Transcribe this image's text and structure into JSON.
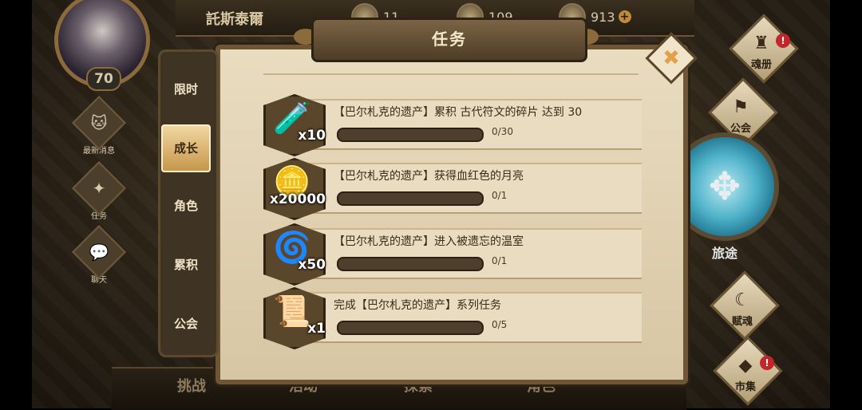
{
  "player": {
    "name": "託斯泰爾",
    "level": "70"
  },
  "resources": [
    {
      "icon": "coin-icon",
      "value": "11"
    },
    {
      "icon": "gem-icon",
      "value": "109"
    },
    {
      "icon": "soul-stone-icon",
      "value": "913"
    }
  ],
  "left_sidebar": [
    {
      "label": "最新消息",
      "icon": "cat-icon"
    },
    {
      "label": "任务",
      "icon": "crest-icon"
    },
    {
      "label": "聊天",
      "icon": "chat-icon"
    }
  ],
  "panel": {
    "title": "任务",
    "close_label": "✖"
  },
  "tabs": [
    {
      "label": "限时",
      "active": false
    },
    {
      "label": "成长",
      "active": true
    },
    {
      "label": "角色",
      "active": false
    },
    {
      "label": "累积",
      "active": false
    },
    {
      "label": "公会",
      "active": false
    }
  ],
  "tasks": [
    {
      "desc": "【巴尔札克的遗产】累积 古代符文的碎片 达到 30",
      "reward_qty": "x10",
      "progress": "0/30",
      "progress_fraction": 0,
      "reward_icon": "potion-icon"
    },
    {
      "desc": "【巴尔札克的遗产】获得血红色的月亮",
      "reward_qty": "x20000",
      "progress": "0/1",
      "progress_fraction": 0,
      "reward_icon": "gold-coin-icon"
    },
    {
      "desc": "【巴尔札克的遗产】进入被遗忘的温室",
      "reward_qty": "x50",
      "progress": "0/1",
      "progress_fraction": 0,
      "reward_icon": "spirit-swirl-icon"
    },
    {
      "desc": "完成【巴尔札克的遗产】系列任务",
      "reward_qty": "x1",
      "progress": "0/5",
      "progress_fraction": 0,
      "reward_icon": "relic-icon"
    }
  ],
  "right_sidebar": [
    {
      "label": "魂册",
      "alert": true
    },
    {
      "label": "公会",
      "alert": false
    },
    {
      "label": "旅途",
      "alert": false
    },
    {
      "label": "赋魂",
      "alert": false
    },
    {
      "label": "市集",
      "alert": true
    }
  ],
  "bottom_nav": [
    "挑战",
    "活动",
    "探索",
    "角色"
  ]
}
